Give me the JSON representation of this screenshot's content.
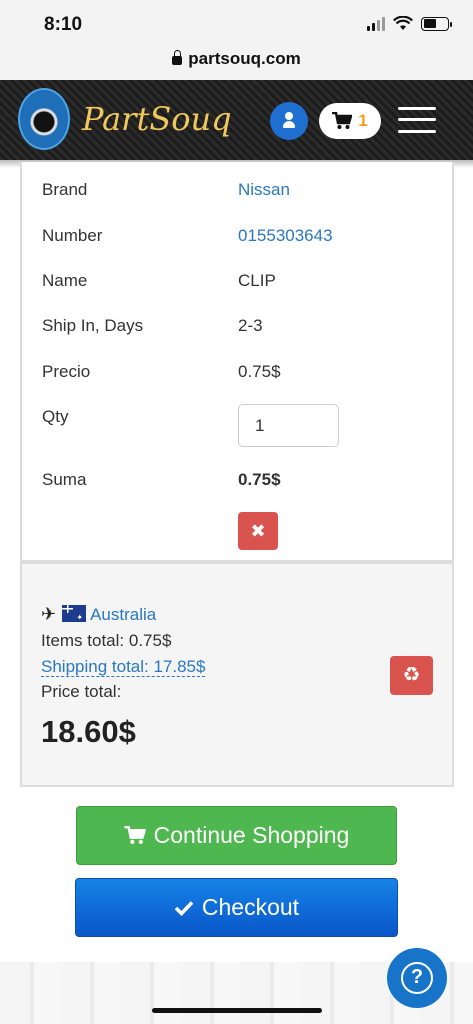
{
  "status_bar": {
    "time": "8:10"
  },
  "browser": {
    "url": "partsouq.com"
  },
  "header": {
    "logo_text": "PartSouq",
    "logo_badge": "PARTSOUQ",
    "cart_count": "1"
  },
  "item": {
    "rows": [
      {
        "label": "Brand",
        "value": "Nissan"
      },
      {
        "label": "Number",
        "value": "0155303643"
      },
      {
        "label": "Name",
        "value": "CLIP"
      },
      {
        "label": "Ship In, Days",
        "value": "2-3"
      },
      {
        "label": "Precio",
        "value": "0.75$"
      }
    ],
    "qty_label": "Qty",
    "qty_value": "1",
    "sum_label": "Suma",
    "sum_value": "0.75$",
    "delete_glyph": "✖"
  },
  "summary": {
    "country": "Australia",
    "items_total": "Items total: 0.75$",
    "shipping_total": "Shipping total: 17.85$",
    "price_total_label": "Price total:",
    "price_total": "18.60$",
    "recycle_glyph": "♻"
  },
  "actions": {
    "continue_label": "Continue Shopping",
    "checkout_label": "Checkout"
  },
  "help": {
    "glyph": "?"
  },
  "colors": {
    "link": "#2a78c2",
    "danger": "#d9534f",
    "continue": "#4fb74f",
    "checkout": "#0a56c8",
    "logo_text": "#f1c85b",
    "cart_count": "#f0a020"
  },
  "icons": [
    "signal-icon",
    "wifi-icon",
    "battery-icon",
    "lock-icon",
    "user-icon",
    "cart-icon",
    "menu-icon",
    "delete-icon",
    "plane-icon",
    "australia-flag-icon",
    "recycle-icon",
    "check-icon",
    "help-icon"
  ]
}
